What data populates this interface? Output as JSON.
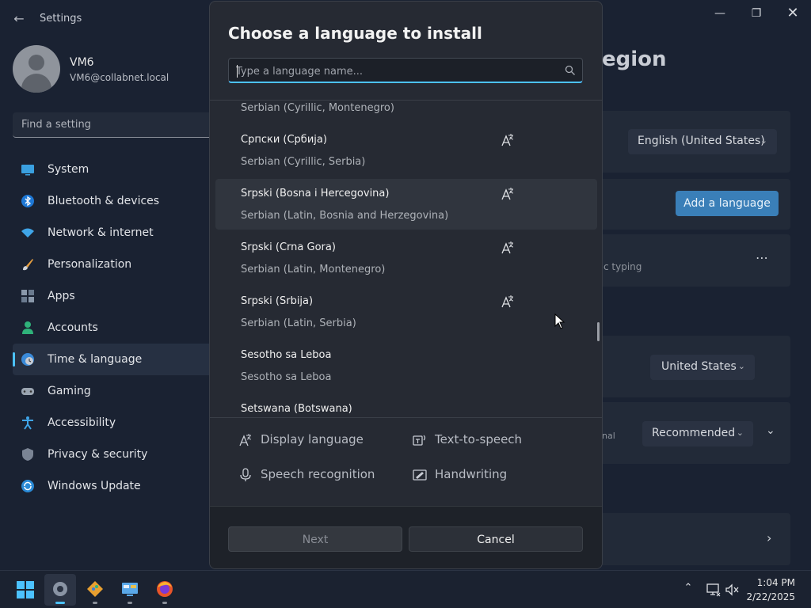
{
  "window": {
    "app_title": "Settings",
    "user": {
      "name": "VM6",
      "email": "VM6@collabnet.local"
    },
    "find_placeholder": "Find a setting",
    "nav_items": [
      {
        "label": "System",
        "icon": "monitor-icon"
      },
      {
        "label": "Bluetooth & devices",
        "icon": "bluetooth-icon"
      },
      {
        "label": "Network & internet",
        "icon": "wifi-icon"
      },
      {
        "label": "Personalization",
        "icon": "brush-icon"
      },
      {
        "label": "Apps",
        "icon": "apps-icon"
      },
      {
        "label": "Accounts",
        "icon": "person-icon"
      },
      {
        "label": "Time & language",
        "icon": "clock-globe-icon",
        "active": true
      },
      {
        "label": "Gaming",
        "icon": "gamepad-icon"
      },
      {
        "label": "Accessibility",
        "icon": "accessibility-icon"
      },
      {
        "label": "Privacy & security",
        "icon": "shield-icon"
      },
      {
        "label": "Windows Update",
        "icon": "update-icon"
      }
    ],
    "page_title_fragment": "egion",
    "display_language_value": "English (United States)",
    "add_language_label": "Add a language",
    "typing_fragment": "c typing",
    "region_value": "United States",
    "format_fragment": "nal",
    "format_value": "Recommended"
  },
  "dialog": {
    "title": "Choose a language to install",
    "search_placeholder": "Type a language name...",
    "languages": [
      {
        "native": "",
        "english": "Serbian (Cyrillic, Montenegro)",
        "display_lang_feature": false,
        "partial": true
      },
      {
        "native": "Српски (Србија)",
        "english": "Serbian (Cyrillic, Serbia)",
        "display_lang_feature": true
      },
      {
        "native": "Srpski (Bosna i Hercegovina)",
        "english": "Serbian (Latin, Bosnia and Herzegovina)",
        "display_lang_feature": true,
        "hovered": true
      },
      {
        "native": "Srpski (Crna Gora)",
        "english": "Serbian (Latin, Montenegro)",
        "display_lang_feature": true
      },
      {
        "native": "Srpski (Srbija)",
        "english": "Serbian (Latin, Serbia)",
        "display_lang_feature": true
      },
      {
        "native": "Sesotho sa Leboa",
        "english": "Sesotho sa Leboa",
        "display_lang_feature": false
      },
      {
        "native": "Setswana (Botswana)",
        "english": "",
        "display_lang_feature": false
      }
    ],
    "legend": [
      {
        "label": "Display language",
        "icon": "display-language-icon"
      },
      {
        "label": "Text-to-speech",
        "icon": "text-to-speech-icon"
      },
      {
        "label": "Speech recognition",
        "icon": "microphone-icon"
      },
      {
        "label": "Handwriting",
        "icon": "handwriting-icon"
      }
    ],
    "next_label": "Next",
    "cancel_label": "Cancel"
  },
  "taskbar": {
    "apps": [
      "start-icon",
      "settings-icon",
      "git-icon",
      "control-panel-icon",
      "firefox-icon"
    ],
    "time": "1:04 PM",
    "date": "2/22/2025"
  },
  "colors": {
    "accent": "#4cc2ff",
    "modal_bg": "#262a33",
    "window_bg": "#1a2232"
  }
}
